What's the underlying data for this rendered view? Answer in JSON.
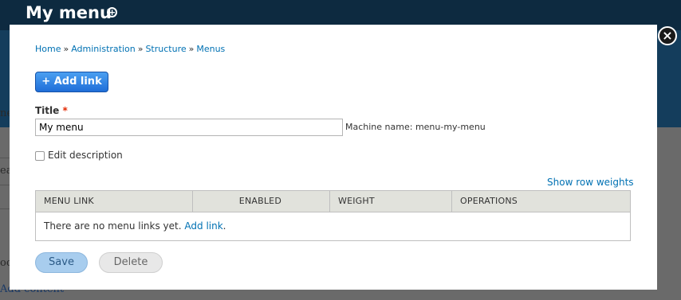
{
  "page": {
    "title": "My menu",
    "shortcut_icon": "plus-circle-icon",
    "bg_fragments": [
      "ne",
      "ea",
      "oo",
      "Add content"
    ]
  },
  "dialog": {
    "close_icon": "close-icon",
    "close_glyph": "×",
    "breadcrumb": [
      "Home",
      "Administration",
      "Structure",
      "Menus"
    ],
    "breadcrumb_separator": "»",
    "add_link_label": "+ Add link",
    "title_label": "Title",
    "required_marker": "*",
    "title_value": "My menu",
    "machine_name": "Machine name: menu-my-menu",
    "edit_description_label": "Edit description",
    "edit_description_checked": false,
    "show_row_weights": "Show row weights",
    "table": {
      "headers": [
        "MENU LINK",
        "ENABLED",
        "WEIGHT",
        "OPERATIONS"
      ],
      "empty_text": "There are no menu links yet.",
      "empty_link": "Add link",
      "empty_suffix": "."
    },
    "save_label": "Save",
    "delete_label": "Delete"
  }
}
